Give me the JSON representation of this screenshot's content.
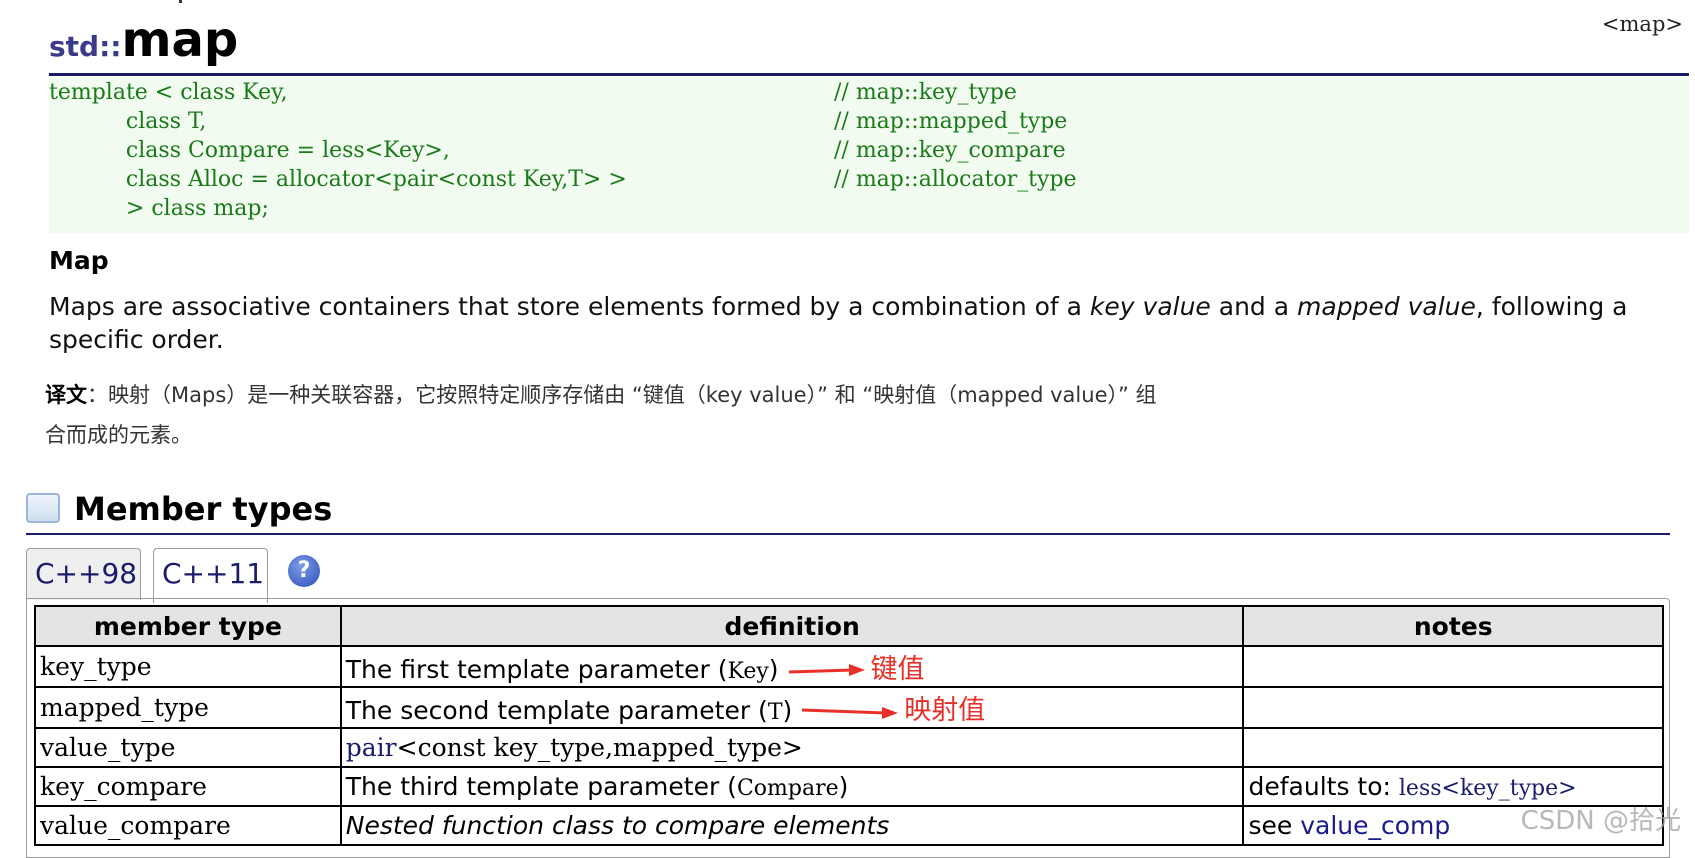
{
  "header_ref": "<map>",
  "title": {
    "namespace": "std::",
    "name": "map"
  },
  "code": {
    "lines": [
      {
        "text": "template < class Key,",
        "comment": "// map::key_type"
      },
      {
        "text": "           class T,",
        "comment": "// map::mapped_type"
      },
      {
        "text": "           class Compare = less<Key>,",
        "comment": "// map::key_compare"
      },
      {
        "text": "           class Alloc = allocator<pair<const Key,T> >",
        "comment": "// map::allocator_type"
      },
      {
        "text": "           > class map;",
        "comment": ""
      }
    ]
  },
  "section_heading": "Map",
  "description": {
    "part1": "Maps are associative containers that store elements formed by a combination of a ",
    "em1": "key value",
    "part2": " and a ",
    "em2": "mapped value",
    "part3": ", following a specific order."
  },
  "translation": {
    "label": "译文",
    "text": "：映射（Maps）是一种关联容器，它按照特定顺序存储由 “键值（key value）” 和 “映射值（mapped value）” 组合而成的元素。"
  },
  "member_types": {
    "heading": "Member types",
    "tabs": [
      {
        "label": "C++98",
        "active": false
      },
      {
        "label": "C++11",
        "active": true
      }
    ],
    "help_icon_label": "?",
    "columns": [
      "member type",
      "definition",
      "notes"
    ],
    "rows": [
      {
        "type": "key_type",
        "def_text": "The first template parameter (",
        "def_code": "Key",
        "def_end": ")",
        "annotation": "键值",
        "notes": ""
      },
      {
        "type": "mapped_type",
        "def_text": "The second template parameter (",
        "def_code": "T",
        "def_end": ")",
        "annotation": "映射值",
        "notes": ""
      },
      {
        "type": "value_type",
        "def_link": "pair",
        "def_code2": "<const key_type,mapped_type>",
        "notes": ""
      },
      {
        "type": "key_compare",
        "def_text": "The third template parameter (",
        "def_code": "Compare",
        "def_end": ")",
        "notes_text": "defaults to: ",
        "notes_code": "less<key_type>"
      },
      {
        "type": "value_compare",
        "def_italic": "Nested function class to compare elements",
        "notes_text": "see ",
        "notes_link": "value_comp"
      }
    ]
  },
  "watermark": "CSDN @拾光",
  "colors": {
    "title_rule": "#1b1b6b",
    "code_green": "#1a7a1a",
    "annotation_red": "#e8302a",
    "code_bg": "#f2fbf0"
  }
}
